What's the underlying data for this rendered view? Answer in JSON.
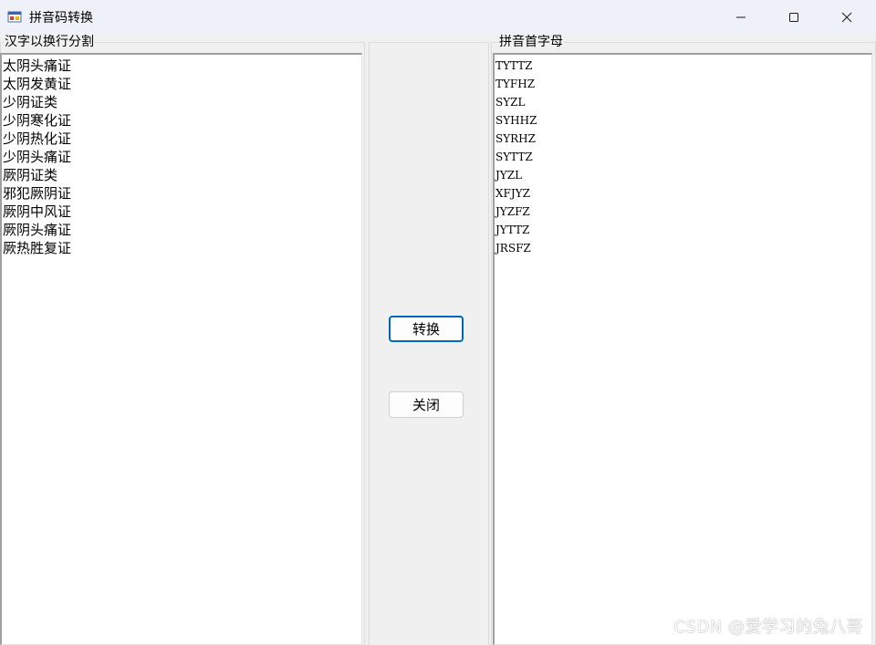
{
  "window": {
    "title": "拼音码转换",
    "icon": "app-window-icon"
  },
  "left_group": {
    "label": "汉字以换行分割",
    "lines": [
      "太阴头痛证",
      "太阴发黄证",
      "少阴证类",
      "少阴寒化证",
      "少阴热化证",
      "少阴头痛证",
      "厥阴证类",
      "邪犯厥阴证",
      "厥阴中风证",
      "厥阴头痛证",
      "厥热胜复证"
    ]
  },
  "right_group": {
    "label": "拼音首字母",
    "lines": [
      "TYTTZ",
      "TYFHZ",
      "SYZL",
      "SYHHZ",
      "SYRHZ",
      "SYTTZ",
      "JYZL",
      "XFJYZ",
      "JYZFZ",
      "JYTTZ",
      "JRSFZ"
    ]
  },
  "buttons": {
    "convert": "转换",
    "close": "关闭"
  },
  "watermark": "CSDN @爱学习的兔八哥",
  "colors": {
    "focus_border": "#0067c0",
    "titlebar_bg": "#eff1f8"
  }
}
